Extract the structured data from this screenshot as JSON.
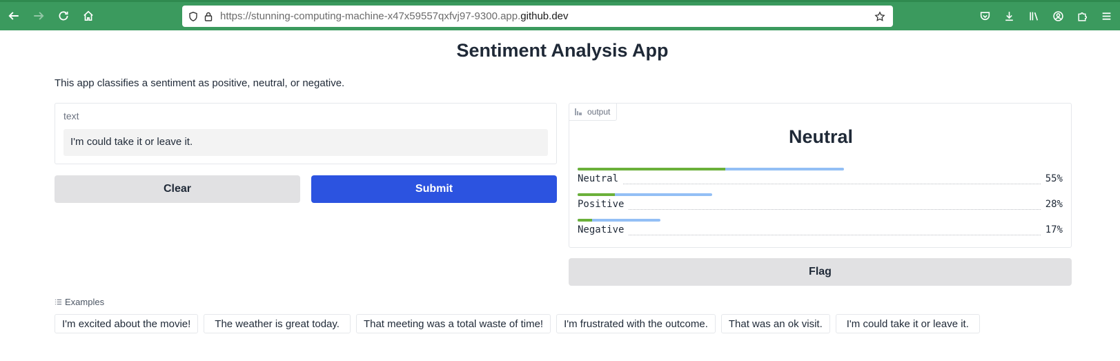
{
  "browser": {
    "url_prefix": "https://stunning-computing-machine-x47x59557qxfvj97-9300.app.",
    "url_host": "github.dev"
  },
  "app": {
    "title": "Sentiment Analysis App",
    "description": "This app classifies a sentiment as positive, neutral, or negative."
  },
  "input": {
    "label": "text",
    "value": "I'm could take it or leave it."
  },
  "buttons": {
    "clear": "Clear",
    "submit": "Submit",
    "flag": "Flag"
  },
  "output": {
    "tab_label": "output",
    "predicted_label": "Neutral",
    "confidences": [
      {
        "label": "Neutral",
        "value": 0.55,
        "pct_text": "55%"
      },
      {
        "label": "Positive",
        "value": 0.28,
        "pct_text": "28%"
      },
      {
        "label": "Negative",
        "value": 0.17,
        "pct_text": "17%"
      }
    ]
  },
  "examples": {
    "label": "Examples",
    "items": [
      "I'm excited about the movie!",
      "The weather is great today.",
      "That meeting was a total waste of time!",
      "I'm frustrated with the outcome.",
      "That was an ok visit.",
      "I'm could take it or leave it."
    ]
  },
  "colors": {
    "browser_chrome": "#3b9a5e",
    "submit_button": "#2c53e0",
    "bar_track": "#93bff5",
    "bar_fill": "#6bb03a"
  }
}
